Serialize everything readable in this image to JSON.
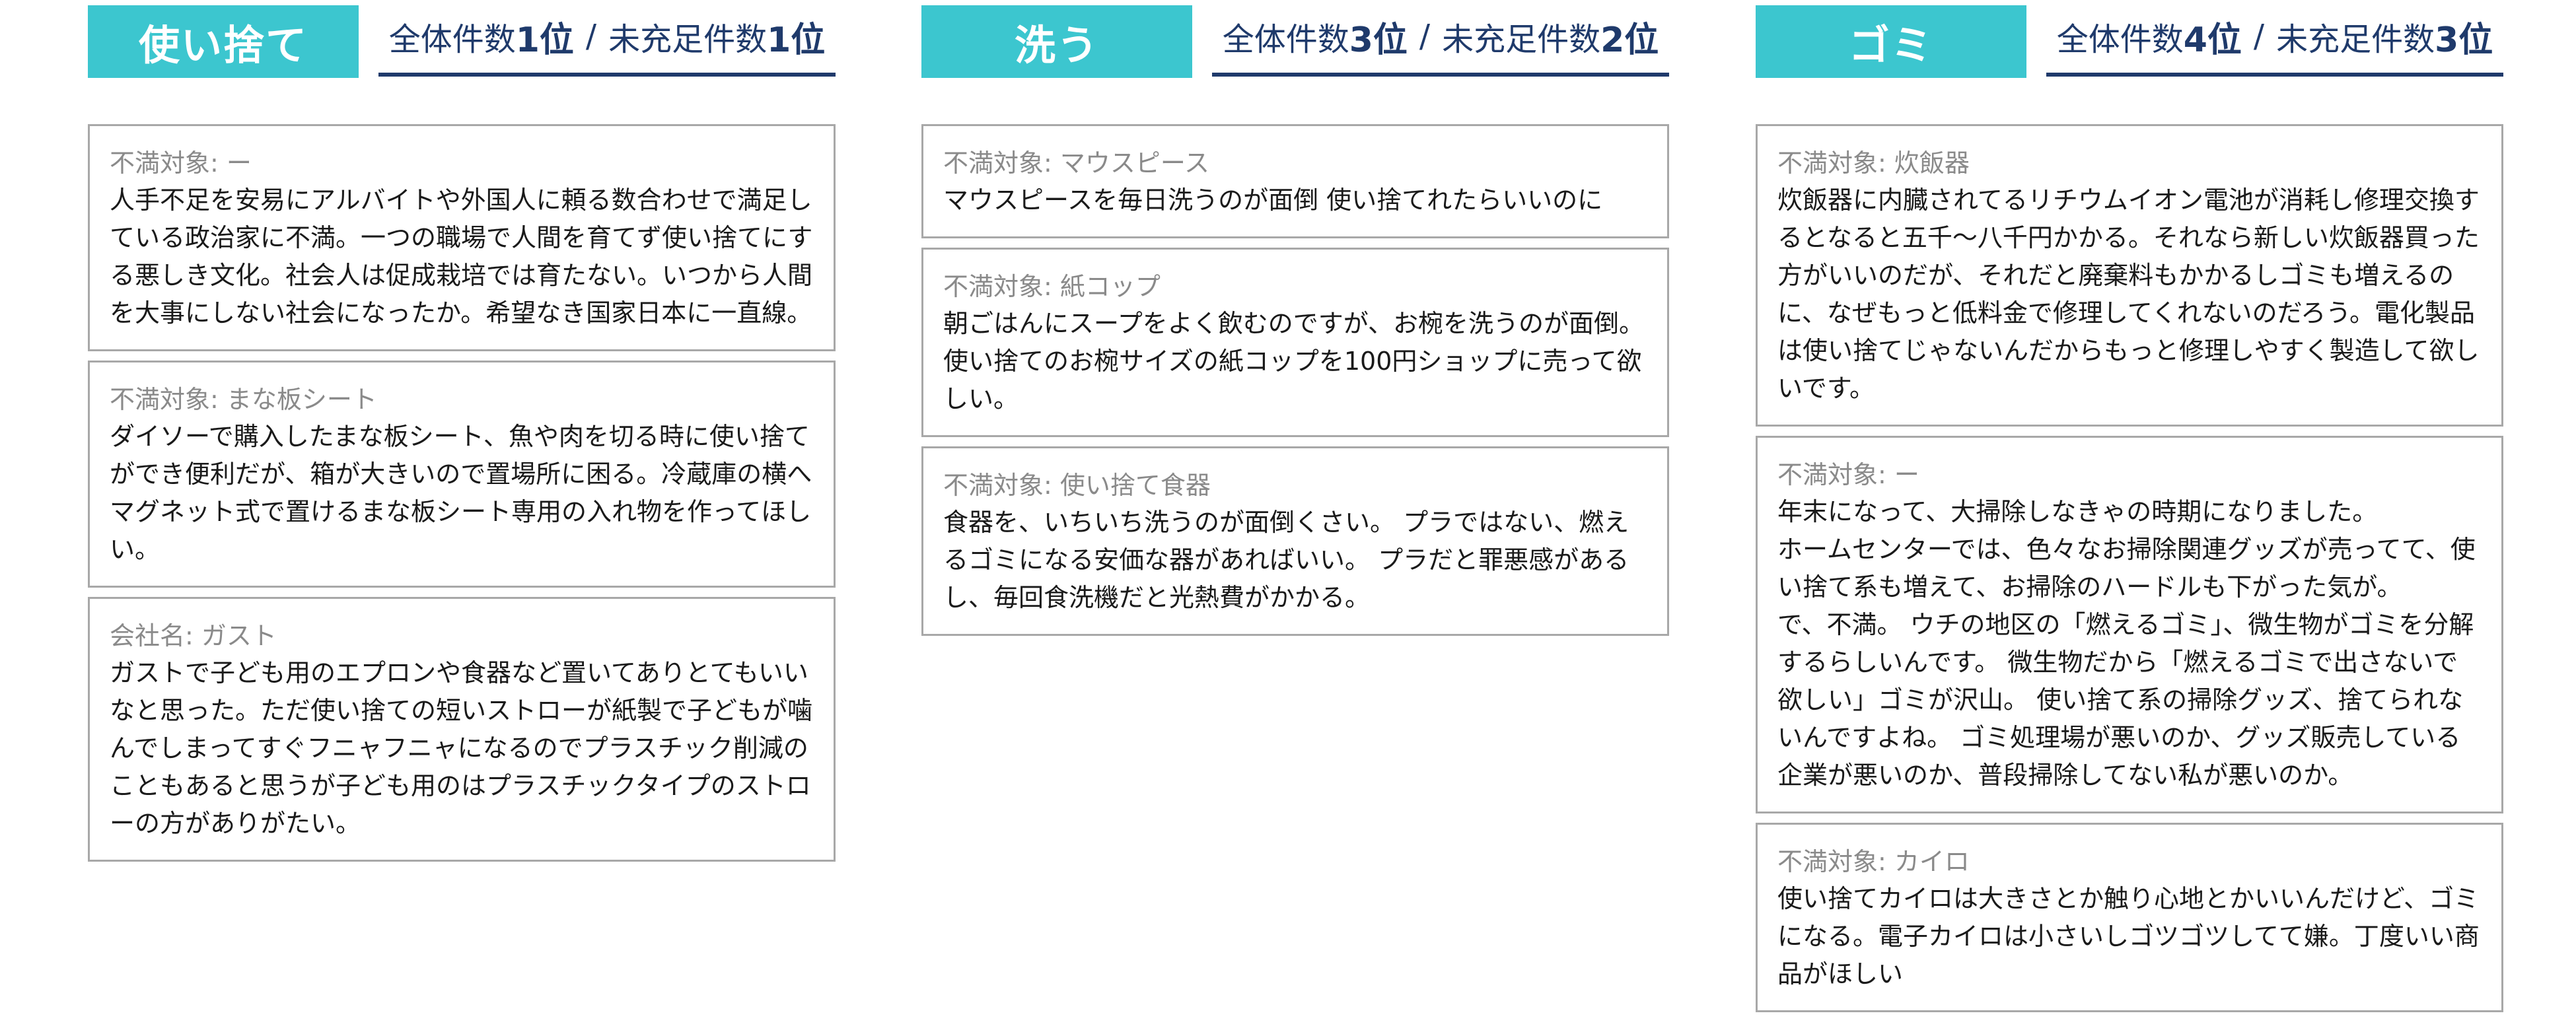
{
  "columns": [
    {
      "tag": "使い捨て",
      "rank": {
        "total_label": "全体件数",
        "total_rank": "1位",
        "separator": "/",
        "unmet_label": "未充足件数",
        "unmet_rank": "1位"
      },
      "cards": [
        {
          "target": "不満対象: ー",
          "body": "人手不足を安易にアルバイトや外国人に頼る数合わせで満足している政治家に不満。一つの職場で人間を育てず使い捨てにする悪しき文化。社会人は促成栽培では育たない。いつから人間を大事にしない社会になったか。希望なき国家日本に一直線。"
        },
        {
          "target": "不満対象: まな板シート",
          "body": "ダイソーで購入したまな板シート、魚や肉を切る時に使い捨てができ便利だが、箱が大きいので置場所に困る。冷蔵庫の横へマグネット式で置けるまな板シート専用の入れ物を作ってほしい。"
        },
        {
          "target": "会社名: ガスト",
          "body": "ガストで子ども用のエプロンや食器など置いてありとてもいいなと思った。ただ使い捨ての短いストローが紙製で子どもが噛んでしまってすぐフニャフニャになるのでプラスチック削減のこともあると思うが子ども用のはプラスチックタイプのストローの方がありがたい。"
        }
      ]
    },
    {
      "tag": "洗う",
      "rank": {
        "total_label": "全体件数",
        "total_rank": "3位",
        "separator": "/",
        "unmet_label": "未充足件数",
        "unmet_rank": "2位"
      },
      "cards": [
        {
          "target": "不満対象: マウスピース",
          "body": "マウスピースを毎日洗うのが面倒 使い捨てれたらいいのに"
        },
        {
          "target": "不満対象: 紙コップ",
          "body": "朝ごはんにスープをよく飲むのですが、お椀を洗うのが面倒。使い捨てのお椀サイズの紙コップを100円ショップに売って欲しい。"
        },
        {
          "target": "不満対象: 使い捨て食器",
          "body": "食器を、いちいち洗うのが面倒くさい。 プラではない、燃えるゴミになる安価な器があればいい。 プラだと罪悪感があるし、毎回食洗機だと光熱費がかかる。"
        }
      ]
    },
    {
      "tag": "ゴミ",
      "rank": {
        "total_label": "全体件数",
        "total_rank": "4位",
        "separator": "/",
        "unmet_label": "未充足件数",
        "unmet_rank": "3位"
      },
      "cards": [
        {
          "target": "不満対象: 炊飯器",
          "body": "炊飯器に内臓されてるリチウムイオン電池が消耗し修理交換するとなると五千〜八千円かかる。それなら新しい炊飯器買った方がいいのだが、それだと廃棄料もかかるしゴミも増えるのに、なぜもっと低料金で修理してくれないのだろう。電化製品は使い捨てじゃないんだからもっと修理しやすく製造して欲しいです。"
        },
        {
          "target": "不満対象: ー",
          "body": "年末になって、大掃除しなきゃの時期になりました。\nホームセンターでは、色々なお掃除関連グッズが売ってて、使い捨て系も増えて、お掃除のハードルも下がった気が。\nで、不満。 ウチの地区の「燃えるゴミ」、微生物がゴミを分解するらしいんです。 微生物だから「燃えるゴミで出さないで欲しい」ゴミが沢山。 使い捨て系の掃除グッズ、捨てられないんですよね。 ゴミ処理場が悪いのか、グッズ販売している企業が悪いのか、普段掃除してない私が悪いのか。"
        },
        {
          "target": "不満対象: カイロ",
          "body": "使い捨てカイロは大きさとか触り心地とかいいんだけど、ゴミになる。電子カイロは小さいしゴツゴツしてて嫌。丁度いい商品がほしい"
        }
      ]
    }
  ]
}
